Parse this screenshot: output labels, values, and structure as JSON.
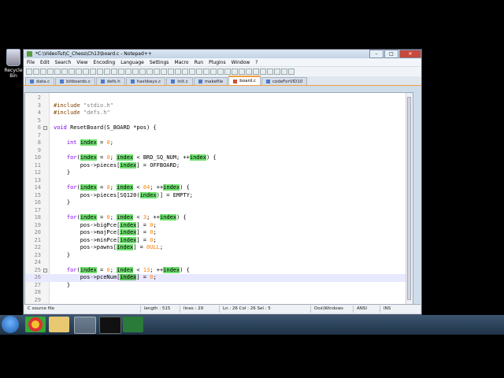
{
  "desktop": {
    "recycle_label": "Recycle Bin"
  },
  "window": {
    "title": "*C:\\VideoTut\\C_Chess\\Ch13\\board.c - Notepad++",
    "menu": [
      "File",
      "Edit",
      "Search",
      "View",
      "Encoding",
      "Language",
      "Settings",
      "Macro",
      "Run",
      "Plugins",
      "Window",
      "?"
    ],
    "tabs": [
      {
        "label": "data.c",
        "active": false
      },
      {
        "label": "bitboards.c",
        "active": false
      },
      {
        "label": "defs.h",
        "active": false
      },
      {
        "label": "hashkeys.c",
        "active": false
      },
      {
        "label": "init.c",
        "active": false
      },
      {
        "label": "makefile",
        "active": false
      },
      {
        "label": "board.c",
        "active": true
      },
      {
        "label": "codeForVID10",
        "active": false
      }
    ]
  },
  "code_lines": [
    {
      "n": "2",
      "segs": []
    },
    {
      "n": "3",
      "segs": [
        {
          "t": "#include ",
          "c": "pp"
        },
        {
          "t": "\"stdio.h\"",
          "c": "str"
        }
      ]
    },
    {
      "n": "4",
      "segs": [
        {
          "t": "#include ",
          "c": "pp"
        },
        {
          "t": "\"defs.h\"",
          "c": "str"
        }
      ]
    },
    {
      "n": "5",
      "segs": []
    },
    {
      "n": "6",
      "fold": "-",
      "segs": [
        {
          "t": "void",
          "c": "ty"
        },
        {
          "t": " ResetBoard(S_BOARD *pos) {",
          "c": ""
        }
      ]
    },
    {
      "n": "7",
      "segs": []
    },
    {
      "n": "8",
      "segs": [
        {
          "t": "    "
        },
        {
          "t": "int",
          "c": "ty"
        },
        {
          "t": " "
        },
        {
          "t": "index",
          "c": "hl"
        },
        {
          "t": " = "
        },
        {
          "t": "0",
          "c": "num"
        },
        {
          "t": ";"
        }
      ]
    },
    {
      "n": "9",
      "segs": []
    },
    {
      "n": "10",
      "segs": [
        {
          "t": "    "
        },
        {
          "t": "for",
          "c": "kw"
        },
        {
          "t": "("
        },
        {
          "t": "index",
          "c": "hl"
        },
        {
          "t": " = "
        },
        {
          "t": "0",
          "c": "num"
        },
        {
          "t": "; "
        },
        {
          "t": "index",
          "c": "hl"
        },
        {
          "t": " < BRD_SQ_NUM; ++"
        },
        {
          "t": "index",
          "c": "hl"
        },
        {
          "t": ") {"
        }
      ]
    },
    {
      "n": "11",
      "segs": [
        {
          "t": "        pos->pieces["
        },
        {
          "t": "index",
          "c": "hl"
        },
        {
          "t": "] = OFFBOARD;"
        }
      ]
    },
    {
      "n": "12",
      "segs": [
        {
          "t": "    }"
        }
      ]
    },
    {
      "n": "13",
      "segs": []
    },
    {
      "n": "14",
      "segs": [
        {
          "t": "    "
        },
        {
          "t": "for",
          "c": "kw"
        },
        {
          "t": "("
        },
        {
          "t": "index",
          "c": "hl"
        },
        {
          "t": " = "
        },
        {
          "t": "0",
          "c": "num"
        },
        {
          "t": "; "
        },
        {
          "t": "index",
          "c": "hl"
        },
        {
          "t": " < "
        },
        {
          "t": "64",
          "c": "num"
        },
        {
          "t": "; ++"
        },
        {
          "t": "index",
          "c": "hl"
        },
        {
          "t": ") {"
        }
      ]
    },
    {
      "n": "15",
      "segs": [
        {
          "t": "        pos->pieces[SQ120("
        },
        {
          "t": "index",
          "c": "hl"
        },
        {
          "t": ")] = EMPTY;"
        }
      ]
    },
    {
      "n": "16",
      "segs": [
        {
          "t": "    }"
        }
      ]
    },
    {
      "n": "17",
      "segs": []
    },
    {
      "n": "18",
      "segs": [
        {
          "t": "    "
        },
        {
          "t": "for",
          "c": "kw"
        },
        {
          "t": "("
        },
        {
          "t": "index",
          "c": "hl"
        },
        {
          "t": " = "
        },
        {
          "t": "0",
          "c": "num"
        },
        {
          "t": "; "
        },
        {
          "t": "index",
          "c": "hl"
        },
        {
          "t": " < "
        },
        {
          "t": "3",
          "c": "num"
        },
        {
          "t": "; ++"
        },
        {
          "t": "index",
          "c": "hl"
        },
        {
          "t": ") {"
        }
      ]
    },
    {
      "n": "19",
      "segs": [
        {
          "t": "        pos->bigPce["
        },
        {
          "t": "index",
          "c": "hl"
        },
        {
          "t": "] = "
        },
        {
          "t": "0",
          "c": "num"
        },
        {
          "t": ";"
        }
      ]
    },
    {
      "n": "20",
      "segs": [
        {
          "t": "        pos->majPce["
        },
        {
          "t": "index",
          "c": "hl"
        },
        {
          "t": "] = "
        },
        {
          "t": "0",
          "c": "num"
        },
        {
          "t": ";"
        }
      ]
    },
    {
      "n": "21",
      "segs": [
        {
          "t": "        pos->minPce["
        },
        {
          "t": "index",
          "c": "hl"
        },
        {
          "t": "] = "
        },
        {
          "t": "0",
          "c": "num"
        },
        {
          "t": ";"
        }
      ]
    },
    {
      "n": "22",
      "segs": [
        {
          "t": "        pos->pawns["
        },
        {
          "t": "index",
          "c": "hl"
        },
        {
          "t": "] = "
        },
        {
          "t": "0ULL",
          "c": "num"
        },
        {
          "t": ";"
        }
      ]
    },
    {
      "n": "23",
      "segs": [
        {
          "t": "    }"
        }
      ]
    },
    {
      "n": "24",
      "segs": []
    },
    {
      "n": "25",
      "fold": "-",
      "segs": [
        {
          "t": "    "
        },
        {
          "t": "for",
          "c": "kw"
        },
        {
          "t": "("
        },
        {
          "t": "index",
          "c": "hl"
        },
        {
          "t": " = "
        },
        {
          "t": "0",
          "c": "num"
        },
        {
          "t": "; "
        },
        {
          "t": "index",
          "c": "hl"
        },
        {
          "t": " < "
        },
        {
          "t": "13",
          "c": "num"
        },
        {
          "t": "; ++"
        },
        {
          "t": "index",
          "c": "hl"
        },
        {
          "t": ") {"
        }
      ]
    },
    {
      "n": "26",
      "current": true,
      "segs": [
        {
          "t": "        pos->pceNum["
        },
        {
          "t": "index",
          "c": "hl sel"
        },
        {
          "t": "] = "
        },
        {
          "t": "0",
          "c": "num"
        },
        {
          "t": ";"
        }
      ]
    },
    {
      "n": "27",
      "segs": [
        {
          "t": "    }"
        }
      ]
    },
    {
      "n": "28",
      "segs": []
    },
    {
      "n": "29",
      "segs": []
    },
    {
      "n": "30",
      "segs": [
        {
          "t": "}"
        }
      ]
    }
  ],
  "status": {
    "filetype": "C source file",
    "length": "length : 515",
    "lines": "lines : 29",
    "pos": "Ln : 26   Col : 26   Sel : 5",
    "eol": "Dos\\Windows",
    "enc": "ANSI",
    "ins": "INS"
  },
  "colors": {
    "highlight": "#70e070",
    "tab_accent": "#f0a040",
    "keyword": "#8000ff",
    "number": "#ff8000"
  }
}
